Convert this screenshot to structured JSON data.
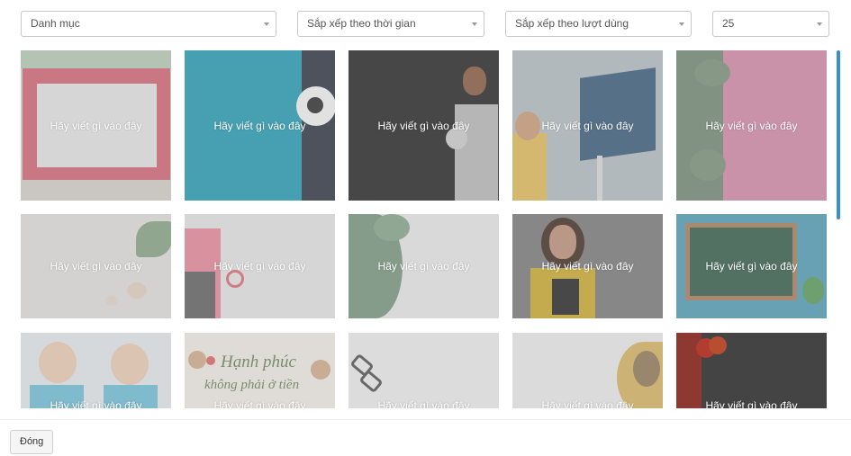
{
  "filters": {
    "category": "Danh mục",
    "sort_time": "Sắp xếp theo thời gian",
    "sort_usage": "Sắp xếp theo lượt dùng",
    "page_size": "25"
  },
  "tiles": [
    {
      "caption": "Hãy viết gì vào đây",
      "thumb": "red-frame-on-green-background"
    },
    {
      "caption": "Hãy viết gì vào đây",
      "thumb": "soccer-ball-on-teal-background"
    },
    {
      "caption": "Hãy viết gì vào đây",
      "thumb": "man-holding-soccer-ball"
    },
    {
      "caption": "Hãy viết gì vào đây",
      "thumb": "woman-with-blank-sign"
    },
    {
      "caption": "Hãy viết gì vào đây",
      "thumb": "palm-leaves-on-pink"
    },
    {
      "caption": "Hãy viết gì vào đây",
      "thumb": "seashells-and-palm"
    },
    {
      "caption": "Hãy viết gì vào đây",
      "thumb": "pink-bag-and-clock"
    },
    {
      "caption": "Hãy viết gì vào đây",
      "thumb": "tropical-leaves"
    },
    {
      "caption": "Hãy viết gì vào đây",
      "thumb": "woman-with-books"
    },
    {
      "caption": "Hãy viết gì vào đây",
      "thumb": "green-chalkboard"
    },
    {
      "caption": "Hãy viết gì vào đây",
      "thumb": "two-smiling-boys"
    },
    {
      "caption": "Hãy viết gì vào đây",
      "thumb": "hanh-phuc-quote-card"
    },
    {
      "caption": "Hãy viết gì vào đây",
      "thumb": "glasses-on-white"
    },
    {
      "caption": "Hãy viết gì vào đây",
      "thumb": "fruit-basket"
    },
    {
      "caption": "Hãy viết gì vào đây",
      "thumb": "tomatoes-on-dark-wood"
    }
  ],
  "tile_art_text": {
    "line1": "Hạnh phúc",
    "line2": "không phải ở tiền"
  },
  "footer": {
    "close_label": "Đóng"
  }
}
